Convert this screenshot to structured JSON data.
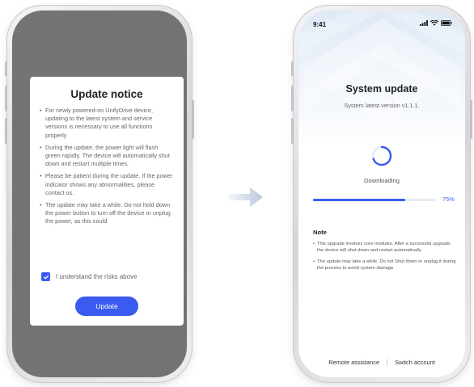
{
  "colors": {
    "accent": "#3a5bf0",
    "overlay": "#737373"
  },
  "notice": {
    "title": "Update notice",
    "items": [
      "For newly powered-on UnifyDrive device, updating to the latest system and service versions is necessary to use all functions properly",
      "During the update, the power light will flash green rapidly. The device will automatically shut down and restart multiple times.",
      "Please be patient during the update. If the power indicator shows any abnormalities, please contact us.",
      "The update may take a while. Do not hold down the power button to turn off the device or unplug the power, as this could"
    ],
    "agree_label": "I understand the risks above",
    "agree_checked": true,
    "update_button": "Update"
  },
  "status_bar": {
    "time": "9:41"
  },
  "update_screen": {
    "title": "System update",
    "subtitle": "System latest  version v1.1.1.",
    "status": "Downloading",
    "progress_percent": 75,
    "progress_label": "75%",
    "note_title": "Note",
    "notes": [
      "This upgrade involves core modules. After a successful upgrade, the device will shut down and restart automatically",
      "The update may take a while. Do not Shut down or unplug it during the process to avoid system damage"
    ],
    "footer": {
      "remote": "Remote assistance",
      "switch": "Switch account"
    }
  }
}
